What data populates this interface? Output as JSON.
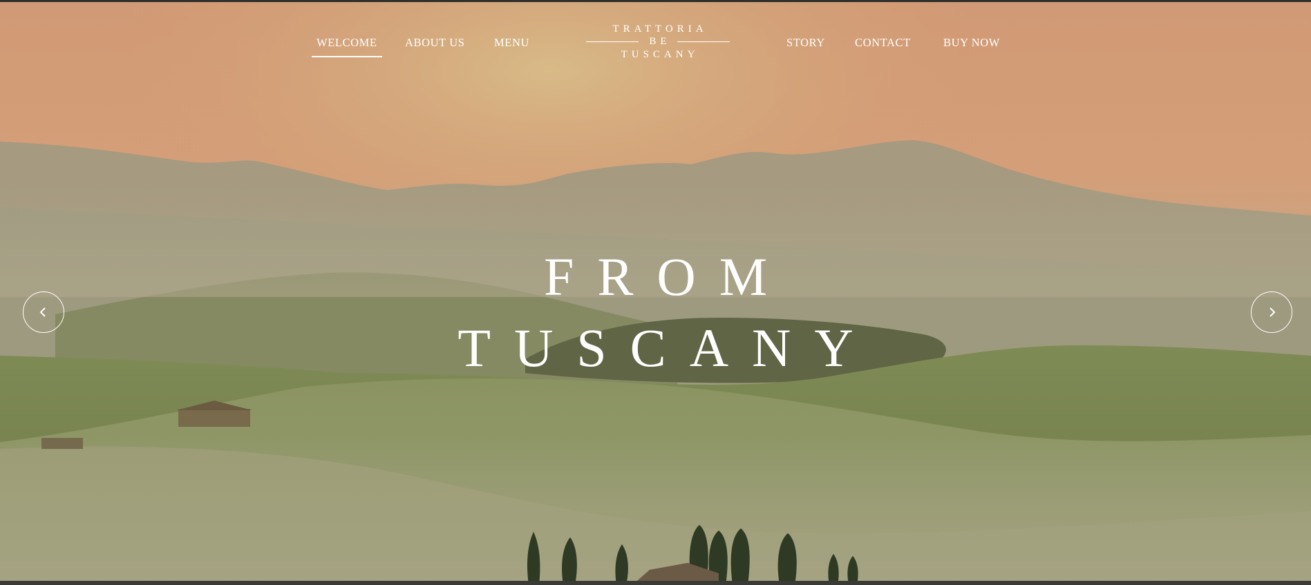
{
  "site": {
    "logo": {
      "line1": "TRATTORIA",
      "line2": "BE",
      "line3": "TUSCANY"
    }
  },
  "nav": {
    "left": [
      {
        "label": "WELCOME",
        "active": true
      },
      {
        "label": "ABOUT US",
        "active": false
      },
      {
        "label": "MENU",
        "active": false
      }
    ],
    "right": [
      {
        "label": "STORY",
        "active": false
      },
      {
        "label": "CONTACT",
        "active": false
      },
      {
        "label": "BUY NOW",
        "active": false
      }
    ]
  },
  "hero": {
    "headline_line1": "FROM",
    "headline_line2": "TUSCANY",
    "prev_icon": "chevron-left-icon",
    "next_icon": "chevron-right-icon"
  },
  "colors": {
    "sky_top": "#d39a72",
    "sky_glow": "#d9b483",
    "mountains": "#a89a82",
    "hills_green": "#7c8656",
    "text": "#ffffff"
  }
}
